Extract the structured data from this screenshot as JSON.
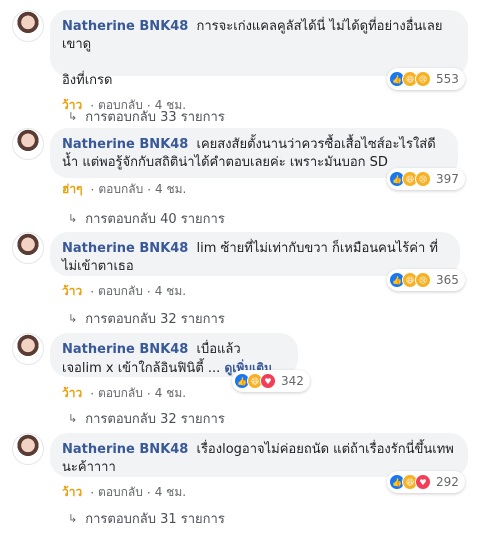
{
  "comments": [
    {
      "author": "Natherine BNK48",
      "text": "การจะเก่งแคลคูลัสได้นี่ ไม่ได้ดูที่อย่างอื่นเลย เขาดู\n\nอิงที่เกรด",
      "reaction_count": "553",
      "reaction_label": "ว้าว",
      "reply_label": "ตอบกลับ",
      "time": "4 ชม.",
      "replies_text": "การตอบกลับ 33 รายการ",
      "reaction_icons": [
        "like-icon",
        "haha-icon",
        "sad-icon"
      ]
    },
    {
      "author": "Natherine BNK48",
      "text": "เคยสงสัยตั้งนานว่าควรซื้อเสื้อไซส์อะไรใส่ดีน้ำ แต่พอรู้จักกับสถิติน่าได้คำตอบเลยค่ะ เพราะมันบอก SD",
      "reaction_count": "397",
      "reaction_label": "ฮ่าๆ",
      "reply_label": "ตอบกลับ",
      "time": "4 ชม.",
      "replies_text": "การตอบกลับ 40 รายการ",
      "reaction_icons": [
        "like-icon",
        "haha-icon",
        "sad-icon"
      ]
    },
    {
      "author": "Natherine BNK48",
      "text": "lim ซ้ายที่ไม่เท่ากับขวา ก็เหมือนคนไร้ค่า ที่ไม่เข้าตาเธอ",
      "reaction_count": "365",
      "reaction_label": "ว้าว",
      "reply_label": "ตอบกลับ",
      "time": "4 ชม.",
      "replies_text": "การตอบกลับ 32 รายการ",
      "reaction_icons": [
        "like-icon",
        "haha-icon",
        "sad-icon"
      ]
    },
    {
      "author": "Natherine BNK48",
      "text": "เบื่อแล้ว\nเจอlim x เข้าใกล้อินฟินิตี้ ...",
      "see_more": "ดูเพิ่มเติม",
      "reaction_count": "342",
      "reaction_label": "ว้าว",
      "reply_label": "ตอบกลับ",
      "time": "4 ชม.",
      "replies_text": "การตอบกลับ 32 รายการ",
      "reaction_icons": [
        "like-icon",
        "haha-icon",
        "love-icon"
      ]
    },
    {
      "author": "Natherine BNK48",
      "text": "เรื่องlogอาจไม่ค่อยถนัด แต่ถ้าเรื่องรักนี่ขึ้นเทพนะค้าาาา",
      "reaction_count": "292",
      "reaction_label": "ว้าว",
      "reply_label": "ตอบกลับ",
      "time": "4 ชม.",
      "replies_text": "การตอบกลับ 31 รายการ",
      "reaction_icons": [
        "like-icon",
        "haha-icon",
        "love-icon"
      ]
    }
  ],
  "colors": {
    "link": "#385898",
    "bubble": "#f2f3f5",
    "reacted": "#e8a10d"
  },
  "separator": "·",
  "reply_arrow_icon": "reply-arrow-icon"
}
